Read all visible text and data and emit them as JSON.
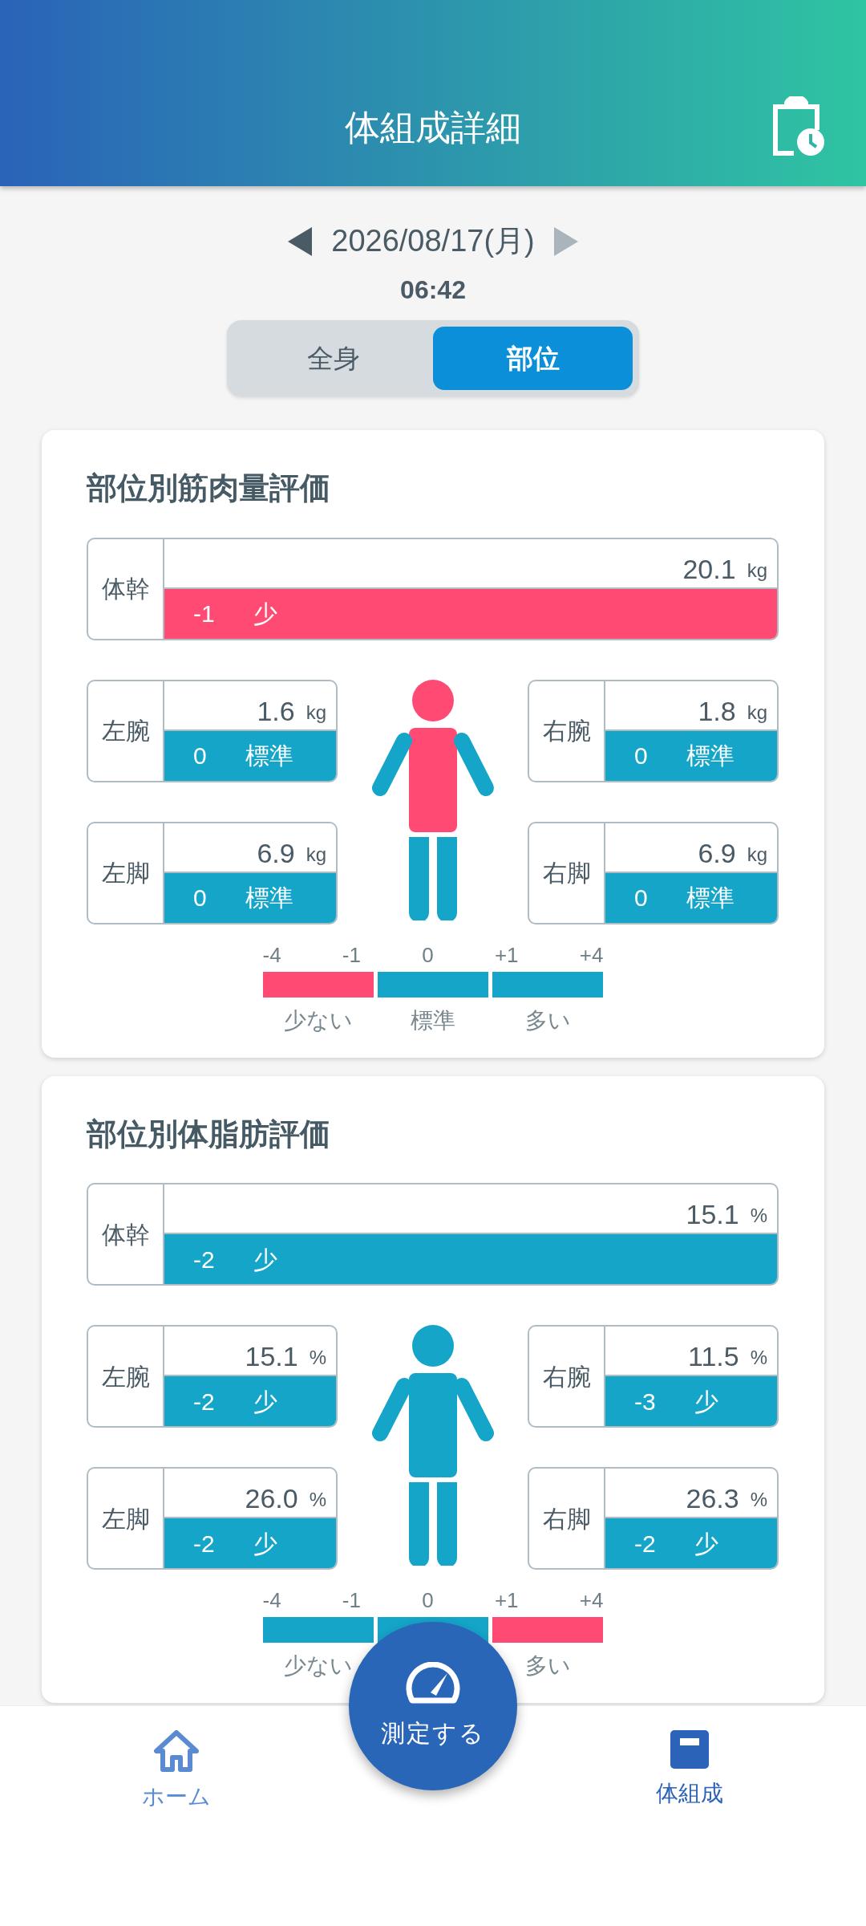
{
  "header": {
    "title": "体組成詳細"
  },
  "date_nav": {
    "date": "2026/08/17(月)",
    "time": "06:42",
    "prev_disabled": false,
    "next_disabled": true
  },
  "view_tabs": [
    {
      "label": "全身",
      "selected": false
    },
    {
      "label": "部位",
      "selected": true
    }
  ],
  "sections": [
    {
      "title": "部位別筋肉量評価",
      "regions": [
        {
          "kind": "trunk",
          "name": "体幹",
          "value": "20.1",
          "unit": "kg",
          "score": "-1",
          "rating": "少",
          "color": "#ff4a74"
        },
        {
          "kind": "left_arm",
          "name": "左腕",
          "value": "1.6",
          "unit": "kg",
          "score": "0",
          "rating": "標準",
          "color": "#14a5c9"
        },
        {
          "kind": "right_arm",
          "name": "右腕",
          "value": "1.8",
          "unit": "kg",
          "score": "0",
          "rating": "標準",
          "color": "#14a5c9"
        },
        {
          "kind": "left_leg",
          "name": "左脚",
          "value": "6.9",
          "unit": "kg",
          "score": "0",
          "rating": "標準",
          "color": "#14a5c9"
        },
        {
          "kind": "right_leg",
          "name": "右脚",
          "value": "6.9",
          "unit": "kg",
          "score": "0",
          "rating": "標準",
          "color": "#14a5c9"
        }
      ],
      "legend": {
        "ticks": [
          "-4",
          "-1",
          "0",
          "+1",
          "+4"
        ],
        "segments": [
          {
            "label": "少ない",
            "color": "#ff4a74"
          },
          {
            "label": "標準",
            "color": "#14a5c9"
          },
          {
            "label": "多い",
            "color": "#14a5c9"
          }
        ]
      }
    },
    {
      "title": "部位別体脂肪評価",
      "regions": [
        {
          "kind": "trunk",
          "name": "体幹",
          "value": "15.1",
          "unit": "%",
          "score": "-2",
          "rating": "少",
          "color": "#14a5c9"
        },
        {
          "kind": "left_arm",
          "name": "左腕",
          "value": "15.1",
          "unit": "%",
          "score": "-2",
          "rating": "少",
          "color": "#14a5c9"
        },
        {
          "kind": "right_arm",
          "name": "右腕",
          "value": "11.5",
          "unit": "%",
          "score": "-3",
          "rating": "少",
          "color": "#14a5c9"
        },
        {
          "kind": "left_leg",
          "name": "左脚",
          "value": "26.0",
          "unit": "%",
          "score": "-2",
          "rating": "少",
          "color": "#14a5c9"
        },
        {
          "kind": "right_leg",
          "name": "右脚",
          "value": "26.3",
          "unit": "%",
          "score": "-2",
          "rating": "少",
          "color": "#14a5c9"
        }
      ],
      "legend": {
        "ticks": [
          "-4",
          "-1",
          "0",
          "+1",
          "+4"
        ],
        "segments": [
          {
            "label": "少ない",
            "color": "#14a5c9"
          },
          {
            "color": "#14a5c9"
          },
          {
            "label": "多い",
            "color": "#ff4a74"
          }
        ]
      }
    }
  ],
  "fab": {
    "label": "測定する"
  },
  "bottom_nav": [
    {
      "label": "ホーム",
      "selected": false
    },
    {
      "label": "体組成",
      "selected": true
    }
  ]
}
